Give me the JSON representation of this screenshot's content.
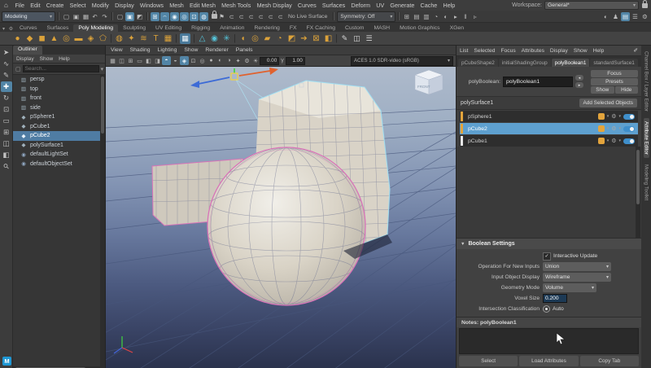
{
  "app": {
    "workspace_label": "Workspace:",
    "workspace_value": "General*",
    "badge": "M"
  },
  "menubar": {
    "items": [
      "File",
      "Edit",
      "Create",
      "Select",
      "Modify",
      "Display",
      "Windows",
      "Mesh",
      "Edit Mesh",
      "Mesh Tools",
      "Mesh Display",
      "Curves",
      "Surfaces",
      "Deform",
      "UV",
      "Generate",
      "Cache",
      "Help"
    ]
  },
  "statusline": {
    "menuset": "Modeling",
    "no_live_surface": "No Live Surface",
    "symmetry": "Symmetry: Off",
    "file_icons": [
      {
        "n": "new-scene-icon",
        "g": "▢",
        "cls": "st-ic"
      },
      {
        "n": "open-scene-icon",
        "g": "▣",
        "cls": "st-ic"
      },
      {
        "n": "save-scene-icon",
        "g": "▦",
        "cls": "st-ic"
      }
    ],
    "undo_icons": [
      {
        "n": "undo-icon",
        "g": "↶",
        "cls": "st-ic"
      },
      {
        "n": "redo-icon",
        "g": "↷",
        "cls": "st-ic"
      }
    ],
    "select_icons": [
      {
        "n": "select-hierarchy-icon",
        "g": "▢",
        "cls": "st-ic"
      },
      {
        "n": "select-object-icon",
        "g": "▣",
        "cls": "st-ic on"
      },
      {
        "n": "select-component-icon",
        "g": "◩",
        "cls": "st-ic"
      }
    ],
    "snap_icons": [
      {
        "n": "snap-grid-icon",
        "g": "⊞",
        "cls": "st-ic on"
      },
      {
        "n": "snap-curve-icon",
        "g": "⌢",
        "cls": "st-ic on"
      },
      {
        "n": "snap-point-icon",
        "g": "◉",
        "cls": "st-ic on"
      },
      {
        "n": "snap-projected-center-icon",
        "g": "◎",
        "cls": "st-ic on"
      },
      {
        "n": "snap-view-plane-icon",
        "g": "⊡",
        "cls": "st-ic on"
      },
      {
        "n": "make-live-icon",
        "g": "◍",
        "cls": "st-ic on"
      }
    ],
    "history_icons": [
      {
        "n": "flag-icon",
        "g": "⚑",
        "cls": "st-ic"
      },
      {
        "n": "magnet-icon",
        "g": "⊂",
        "cls": "st-ic"
      },
      {
        "n": "magnet-icon",
        "g": "⊂",
        "cls": "st-ic"
      },
      {
        "n": "magnet-icon",
        "g": "⊂",
        "cls": "st-ic"
      },
      {
        "n": "magnet-icon",
        "g": "⊂",
        "cls": "st-ic"
      },
      {
        "n": "magnet-icon",
        "g": "⊂",
        "cls": "st-ic"
      },
      {
        "n": "magnet-icon",
        "g": "⊂",
        "cls": "st-ic"
      }
    ],
    "render_icons": [
      {
        "n": "render-view-icon",
        "g": "⊞",
        "cls": "st-ic"
      },
      {
        "n": "render-region-icon",
        "g": "▤",
        "cls": "st-ic"
      },
      {
        "n": "render-current-icon",
        "g": "▥",
        "cls": "st-ic"
      },
      {
        "n": "ipr-render-icon",
        "g": "◔",
        "cls": "st-ic"
      },
      {
        "n": "render-settings-icon",
        "g": "◐",
        "cls": "st-ic"
      },
      {
        "n": "playblast-icon",
        "g": "▸",
        "cls": "st-ic"
      },
      {
        "n": "pause-icon",
        "g": "‖",
        "cls": "st-ic"
      },
      {
        "n": "resume-icon",
        "g": "▹",
        "cls": "st-ic"
      }
    ],
    "right_icons": [
      {
        "n": "character-controls-icon",
        "g": "◐",
        "cls": "st-ic"
      },
      {
        "n": "pose-editor-icon",
        "g": "♟",
        "cls": "st-ic"
      },
      {
        "n": "attribute-editor-toggle-icon",
        "g": "▤",
        "cls": "st-ic on"
      },
      {
        "n": "tool-settings-toggle-icon",
        "g": "☰",
        "cls": "st-ic"
      },
      {
        "n": "channel-box-toggle-icon",
        "g": "⚙",
        "cls": "st-ic"
      }
    ]
  },
  "shelf": {
    "tabs": [
      {
        "label": "Curves",
        "cls": "sh-tab"
      },
      {
        "label": "Surfaces",
        "cls": "sh-tab"
      },
      {
        "label": "Poly Modeling",
        "cls": "sh-tab active"
      },
      {
        "label": "Sculpting",
        "cls": "sh-tab"
      },
      {
        "label": "UV Editing",
        "cls": "sh-tab"
      },
      {
        "label": "Rigging",
        "cls": "sh-tab"
      },
      {
        "label": "Animation",
        "cls": "sh-tab"
      },
      {
        "label": "Rendering",
        "cls": "sh-tab"
      },
      {
        "label": "FX",
        "cls": "sh-tab"
      },
      {
        "label": "FX Caching",
        "cls": "sh-tab"
      },
      {
        "label": "Custom",
        "cls": "sh-tab"
      },
      {
        "label": "MASH",
        "cls": "sh-tab"
      },
      {
        "label": "Motion Graphics",
        "cls": "sh-tab"
      },
      {
        "label": "XGen",
        "cls": "sh-tab"
      }
    ],
    "icons": [
      {
        "g": "●",
        "cls": "shelf-ic o"
      },
      {
        "g": "◆",
        "cls": "shelf-ic o"
      },
      {
        "g": "◼",
        "cls": "shelf-ic o"
      },
      {
        "g": "▲",
        "cls": "shelf-ic o"
      },
      {
        "g": "◎",
        "cls": "shelf-ic o"
      },
      {
        "g": "▬",
        "cls": "shelf-ic o"
      },
      {
        "g": "◈",
        "cls": "shelf-ic o"
      },
      {
        "g": "⬠",
        "cls": "shelf-ic o"
      },
      {
        "g": "|",
        "cls": "shelf-ic sep"
      },
      {
        "g": "◍",
        "cls": "shelf-ic o"
      },
      {
        "g": "✦",
        "cls": "shelf-ic o"
      },
      {
        "g": "≋",
        "cls": "shelf-ic o"
      },
      {
        "g": "T",
        "cls": "shelf-ic o"
      },
      {
        "g": "▦",
        "cls": "shelf-ic o"
      },
      {
        "g": "|",
        "cls": "shelf-ic sep"
      },
      {
        "g": "▦",
        "cls": "shelf-ic b"
      },
      {
        "g": "|",
        "cls": "shelf-ic sep"
      },
      {
        "g": "△",
        "cls": "shelf-ic t"
      },
      {
        "g": "◉",
        "cls": "shelf-ic t"
      },
      {
        "g": "✳",
        "cls": "shelf-ic t"
      },
      {
        "g": "|",
        "cls": "shelf-ic sep"
      },
      {
        "g": "◖",
        "cls": "shelf-ic o"
      },
      {
        "g": "◎",
        "cls": "shelf-ic o"
      },
      {
        "g": "▰",
        "cls": "shelf-ic o"
      },
      {
        "g": "◔",
        "cls": "shelf-ic o"
      },
      {
        "g": "◩",
        "cls": "shelf-ic o"
      },
      {
        "g": "➔",
        "cls": "shelf-ic o"
      },
      {
        "g": "⊠",
        "cls": "shelf-ic o"
      },
      {
        "g": "◧",
        "cls": "shelf-ic o"
      },
      {
        "g": "|",
        "cls": "shelf-ic sep"
      },
      {
        "g": "✎",
        "cls": "shelf-ic w"
      },
      {
        "g": "◫",
        "cls": "shelf-ic w"
      },
      {
        "g": "☰",
        "cls": "shelf-ic w"
      }
    ]
  },
  "toolbox": {
    "tools": [
      {
        "n": "select-tool",
        "g": "➤",
        "cls": "tool"
      },
      {
        "n": "lasso-select-tool",
        "g": "∿",
        "cls": "tool"
      },
      {
        "n": "paint-select-tool",
        "g": "✎",
        "cls": "tool"
      },
      {
        "n": "move-tool",
        "g": "✚",
        "cls": "tool active"
      },
      {
        "n": "rotate-tool",
        "g": "↻",
        "cls": "tool"
      },
      {
        "n": "scale-tool",
        "g": "⊡",
        "cls": "tool"
      },
      {
        "n": "layout-single-pane",
        "g": "▭",
        "cls": "tool"
      },
      {
        "n": "layout-four-pane",
        "g": "⊞",
        "cls": "tool"
      },
      {
        "n": "layout-two-pane",
        "g": "◫",
        "cls": "tool"
      },
      {
        "n": "layout-outliner-persp",
        "g": "◧",
        "cls": "tool"
      },
      {
        "n": "zoom-tool",
        "g": "⚲",
        "cls": "tool zoom"
      }
    ]
  },
  "outliner": {
    "title": "Outliner",
    "menu": [
      "Display",
      "Show",
      "Help"
    ],
    "search_placeholder": "Search...",
    "items": [
      {
        "name": "persp",
        "g": "▥",
        "cls": "ol-row"
      },
      {
        "name": "top",
        "g": "▥",
        "cls": "ol-row"
      },
      {
        "name": "front",
        "g": "▥",
        "cls": "ol-row"
      },
      {
        "name": "side",
        "g": "▥",
        "cls": "ol-row"
      },
      {
        "name": "pSphere1",
        "g": "◆",
        "cls": "ol-row"
      },
      {
        "name": "pCube1",
        "g": "◆",
        "cls": "ol-row"
      },
      {
        "name": "pCube2",
        "g": "◆",
        "cls": "ol-row sel"
      },
      {
        "name": "polySurface1",
        "g": "◆",
        "cls": "ol-row"
      },
      {
        "name": "defaultLightSet",
        "g": "◉",
        "cls": "ol-row set"
      },
      {
        "name": "defaultObjectSet",
        "g": "◉",
        "cls": "ol-row set"
      }
    ]
  },
  "viewport": {
    "menu": [
      "View",
      "Shading",
      "Lighting",
      "Show",
      "Renderer",
      "Panels"
    ],
    "toolbar_icons": [
      {
        "g": "▦",
        "cls": "vp-ic"
      },
      {
        "g": "◫",
        "cls": "vp-ic"
      },
      {
        "g": "⊞",
        "cls": "vp-ic"
      },
      {
        "g": "▭",
        "cls": "vp-ic"
      },
      {
        "g": "◧",
        "cls": "vp-ic"
      },
      {
        "g": "◨",
        "cls": "vp-ic"
      },
      {
        "g": "◓",
        "cls": "vp-ic on"
      },
      {
        "g": "◒",
        "cls": "vp-ic"
      },
      {
        "g": "◈",
        "cls": "vp-ic on"
      },
      {
        "g": "⊡",
        "cls": "vp-ic"
      },
      {
        "g": "◎",
        "cls": "vp-ic"
      },
      {
        "g": "●",
        "cls": "vp-ic"
      },
      {
        "g": "◐",
        "cls": "vp-ic"
      },
      {
        "g": "◑",
        "cls": "vp-ic"
      },
      {
        "g": "✦",
        "cls": "vp-ic"
      },
      {
        "g": "⚙",
        "cls": "vp-ic"
      }
    ],
    "exposure": "0.00",
    "gamma": "1.00",
    "colorspace": "ACES 1.0 SDR-video (sRGB)",
    "viewcube_label": "FRONT"
  },
  "attribute_editor": {
    "menu": [
      "List",
      "Selected",
      "Focus",
      "Attributes",
      "Display",
      "Show",
      "Help"
    ],
    "tabs": [
      {
        "label": "pCubeShape2",
        "cls": "ae-tab"
      },
      {
        "label": "initialShadingGroup",
        "cls": "ae-tab"
      },
      {
        "label": "polyBoolean1",
        "cls": "ae-tab active"
      },
      {
        "label": "standardSurface1",
        "cls": "ae-tab"
      }
    ],
    "node_label": "polyBoolean:",
    "node_name": "polyBoolean1",
    "focus_btn": "Focus",
    "presets_btn": "Presets",
    "show_btn": "Show",
    "hide_btn": "Hide",
    "output_name": "polySurface1",
    "add_selected_btn": "Add Selected Objects",
    "inputs": [
      {
        "name": "pSphere1",
        "cls": "ae-row",
        "bar": "background:#e3a43c"
      },
      {
        "name": "pCube2",
        "cls": "ae-row sel",
        "bar": "background:#e3a43c"
      },
      {
        "name": "pCube1",
        "cls": "ae-row",
        "bar": "background:#e8e8e8"
      }
    ],
    "boolean_settings": {
      "header": "Boolean Settings",
      "interactive_update": "Interactive Update",
      "operation_label": "Operation For New Inputs",
      "operation_value": "Union",
      "display_label": "Input Object Display",
      "display_value": "Wireframe",
      "geometry_label": "Geometry Mode",
      "geometry_value": "Volume",
      "voxel_label": "Voxel Size",
      "voxel_value": "0.200",
      "intersection_label": "Intersection Classification",
      "intersection_value": "Auto"
    },
    "notes_label": "Notes: polyBoolean1",
    "footer": [
      "Select",
      "Load Attributes",
      "Copy Tab"
    ]
  },
  "right_strip": {
    "tabs": [
      {
        "label": "Channel Box / Layer Editor",
        "cls": "rs-tab"
      },
      {
        "label": "Attribute Editor",
        "cls": "rs-tab active"
      },
      {
        "label": "Modeling Toolkit",
        "cls": "rs-tab"
      }
    ]
  },
  "colors": {
    "accent_blue": "#5285a6",
    "selection_blue": "#5ea0cf",
    "shelf_orange": "#dba23a",
    "wire_pink": "#d873b8",
    "wire_cyan": "#9fe0f4"
  }
}
